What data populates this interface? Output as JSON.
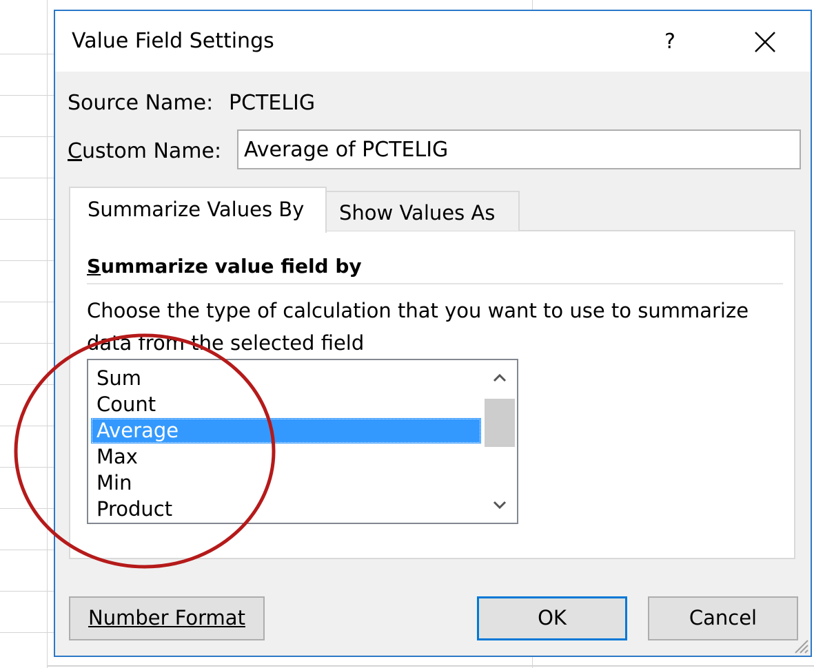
{
  "dialog": {
    "title": "Value Field Settings",
    "help_label": "?",
    "source_label": "Source Name:",
    "source_value": "PCTELIG",
    "custom_label_prefix": "C",
    "custom_label_rest": "ustom Name:",
    "custom_value": "Average of PCTELIG"
  },
  "tabs": [
    {
      "label": "Summarize Values By",
      "active": true
    },
    {
      "label": "Show Values As",
      "active": false
    }
  ],
  "summarize": {
    "title_prefix": "S",
    "title_rest": "ummarize value field by",
    "description": "Choose the type of calculation that you want to use to summarize data from the selected field",
    "options": [
      "Sum",
      "Count",
      "Average",
      "Max",
      "Min",
      "Product"
    ],
    "selected": "Average"
  },
  "buttons": {
    "number_format": "Number Format",
    "ok": "OK",
    "cancel": "Cancel"
  },
  "colors": {
    "accent": "#0078d7",
    "selection": "#3399ff",
    "annotation": "#b51a1a"
  },
  "icons": [
    "help-icon",
    "close-icon",
    "chevron-up-icon",
    "chevron-down-icon",
    "resize-grip-icon"
  ]
}
